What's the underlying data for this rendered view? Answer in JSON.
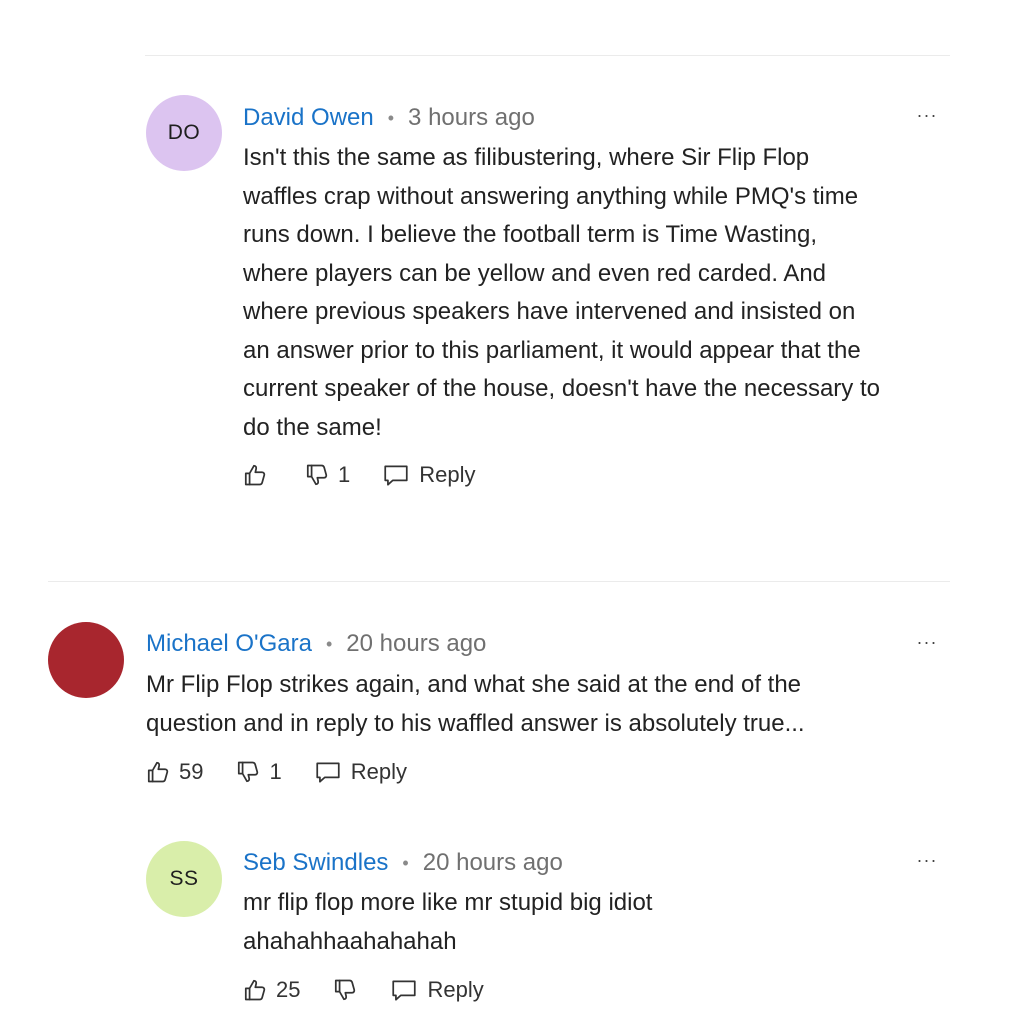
{
  "comments": [
    {
      "initials": "DO",
      "avatar_color": "#dcc4f0",
      "author": "David Owen",
      "separator": "•",
      "time": "3 hours ago",
      "more": "···",
      "lines": [
        "Isn't this the same as filibustering, where Sir Flip Flop",
        "waffles crap without answering anything while PMQ's time",
        "runs down. I believe the football term is Time Wasting,",
        "where players can be yellow and even red carded. And",
        "where previous speakers have intervened and insisted on",
        "an answer prior to this parliament, it would appear that the",
        "current speaker of the house, doesn't have the necessary to",
        "do the same!"
      ],
      "likes": "",
      "dislikes": "1",
      "reply_label": "Reply"
    },
    {
      "initials": "",
      "avatar_color": "#a8262e",
      "author": "Michael O'Gara",
      "separator": "•",
      "time": "20 hours ago",
      "more": "···",
      "lines": [
        "Mr Flip Flop strikes again, and what she said at the end of the",
        "question and in reply to his waffled answer is absolutely true..."
      ],
      "likes": "59",
      "dislikes": "1",
      "reply_label": "Reply"
    },
    {
      "initials": "SS",
      "avatar_color": "#d9eeaa",
      "author": "Seb Swindles",
      "separator": "•",
      "time": "20 hours ago",
      "more": "···",
      "lines": [
        "mr flip flop more like mr stupid big idiot",
        "ahahahhaahahahah"
      ],
      "likes": "25",
      "dislikes": "",
      "reply_label": "Reply"
    }
  ]
}
